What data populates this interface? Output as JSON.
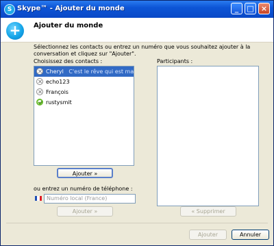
{
  "window": {
    "title": "Skype™ - Ajouter du monde",
    "logo_label": "S",
    "minimize_symbol": "_",
    "maximize_symbol": "□",
    "close_symbol": "×"
  },
  "header": {
    "title": "Ajouter du monde",
    "icon_symbol": "+"
  },
  "instructions": "Sélectionnez les contacts ou entrez un numéro que vous souhaitez ajouter à la conversation et cliquez sur \"Ajouter\".",
  "contacts": {
    "label": "Choisissez des contacts :",
    "items": [
      {
        "name": "Cheryl",
        "mood": "C'est le  rêve qui est ma vie r...",
        "status": "offline"
      },
      {
        "name": "echo123",
        "mood": "",
        "status": "offline"
      },
      {
        "name": "François",
        "mood": "",
        "status": "offline"
      },
      {
        "name": "rustysmit",
        "mood": "",
        "status": "online"
      }
    ],
    "add_button": "Ajouter »"
  },
  "phone": {
    "label": "ou entrez un numéro de téléphone :",
    "placeholder": "Numéro local (France)",
    "add_button": "Ajouter »",
    "flag_colors": [
      "#1f4fb5",
      "#ffffff",
      "#e01b24"
    ]
  },
  "participants": {
    "label": "Participants :",
    "remove_button": "« Supprimer"
  },
  "footer": {
    "add_button": "Ajouter",
    "cancel_button": "Annuler"
  }
}
